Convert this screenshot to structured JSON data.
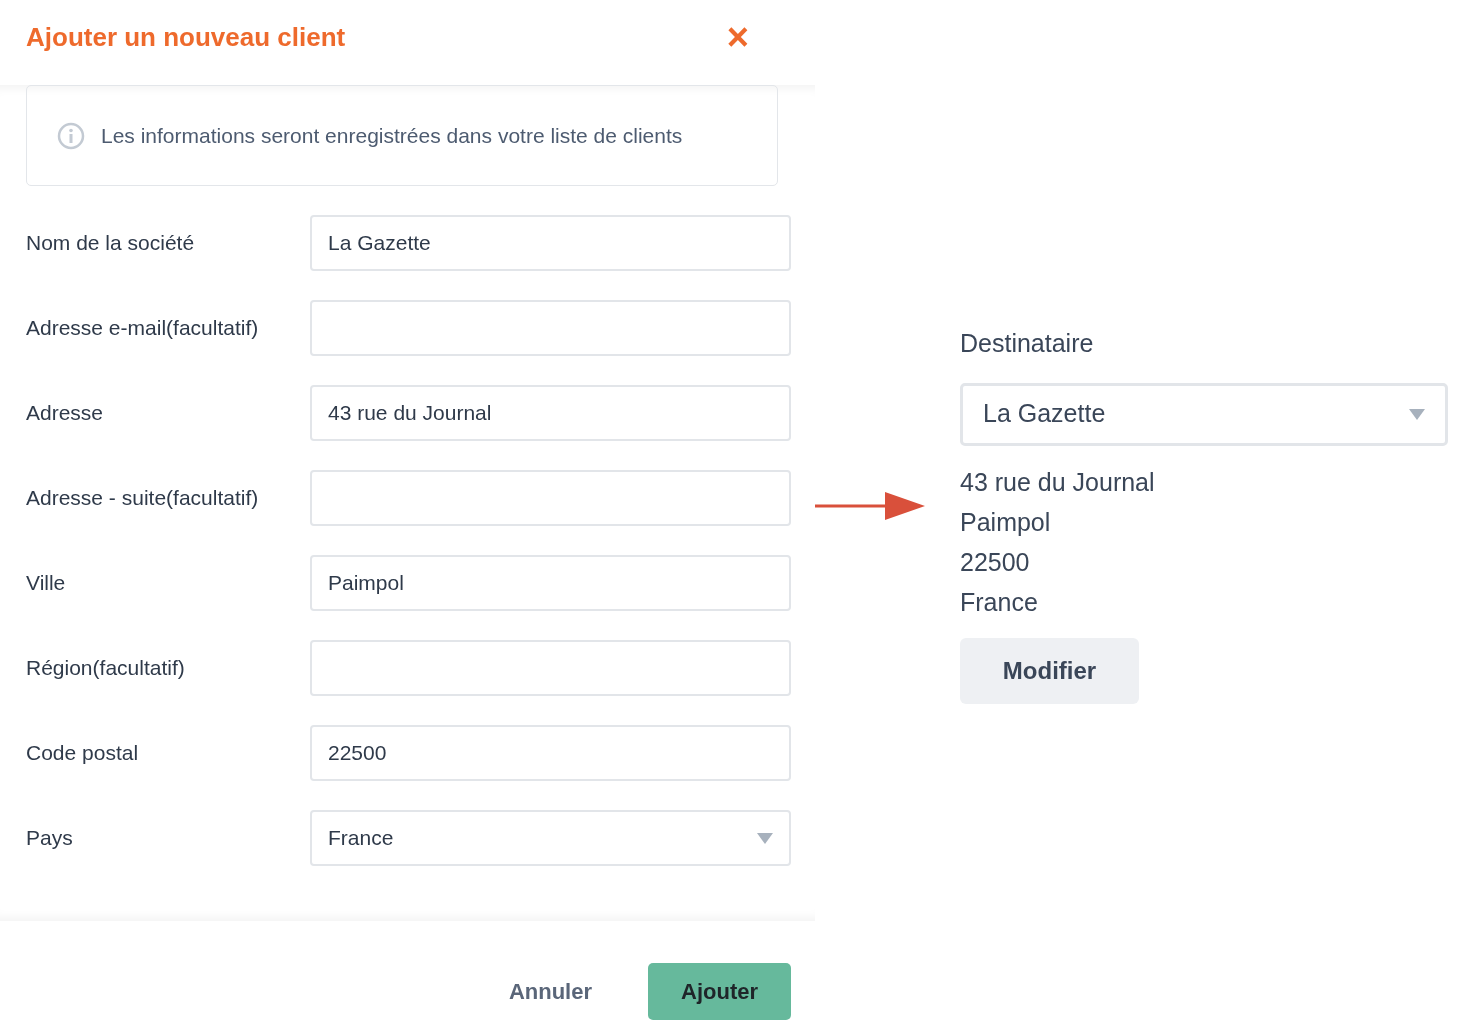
{
  "dialog": {
    "title": "Ajouter un nouveau client",
    "close": "×",
    "info": "Les informations seront enregistrées dans votre liste de clients",
    "fields": [
      {
        "label": "Nom de la société",
        "kind": "text",
        "value": "La Gazette"
      },
      {
        "label": "Adresse e-mail(facultatif)",
        "kind": "text"
      },
      {
        "label": "Adresse",
        "kind": "text",
        "value": "43 rue du Journal"
      },
      {
        "label": "Adresse - suite(facultatif)",
        "kind": "text"
      },
      {
        "label": "Ville",
        "kind": "text",
        "value": "Paimpol"
      },
      {
        "label": "Région(facultatif)",
        "kind": "text"
      },
      {
        "label": "Code postal",
        "kind": "text",
        "value": "22500"
      },
      {
        "label": "Pays",
        "kind": "select",
        "value": "France"
      }
    ],
    "buttons": [
      {
        "label": "Annuler",
        "kind": "cancel"
      },
      {
        "label": "Ajouter",
        "kind": "primary"
      }
    ]
  },
  "recipient": {
    "label": "Destinataire",
    "value": "La Gazette",
    "address_lines": [
      "43 rue du Journal",
      "Paimpol",
      "22500",
      "France"
    ],
    "button": "Modifier"
  }
}
